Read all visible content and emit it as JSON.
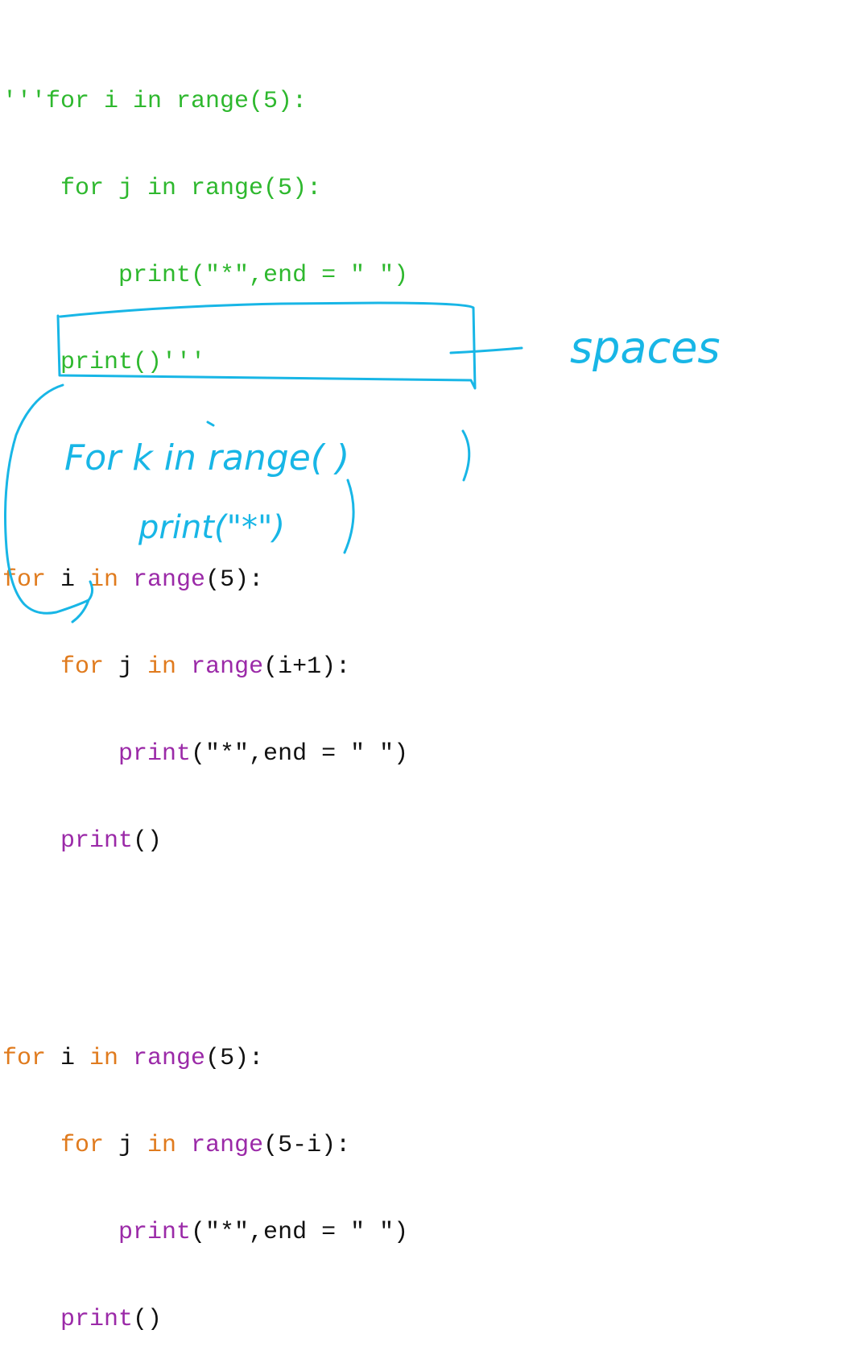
{
  "editor": {
    "block1": {
      "l1": "'''for i in range(5):",
      "l2": "for j in range(5):",
      "l3": "print(\"*\",end = \" \")",
      "l4": "print()'''"
    },
    "block2": {
      "l1_kw": "for",
      "l1_v": " i ",
      "l1_in": "in",
      "l1_fn": " range",
      "l1_arg": "(5):",
      "l2_kw": "for",
      "l2_v": " j ",
      "l2_in": "in",
      "l2_fn": " range",
      "l2_arg": "(i+1):",
      "l3_fn": "print",
      "l3_arg": "(\"*\",end = \" \")",
      "l4_fn": "print",
      "l4_arg": "()"
    },
    "block3": {
      "l1_kw": "for",
      "l1_v": " i ",
      "l1_in": "in",
      "l1_fn": " range",
      "l1_arg": "(5):",
      "l2_kw": "for",
      "l2_v": " j ",
      "l2_in": "in",
      "l2_fn": " range",
      "l2_arg": "(5-i):",
      "l3_fn": "print",
      "l3_arg": "(\"*\",end = \" \")",
      "l4_fn": "print",
      "l4_arg": "()"
    }
  },
  "annotations": {
    "label_spaces": "spaces",
    "note_line1": "For k in range(   )",
    "note_line2": "print(\"*\")",
    "ink_color": "#18b6e6"
  }
}
